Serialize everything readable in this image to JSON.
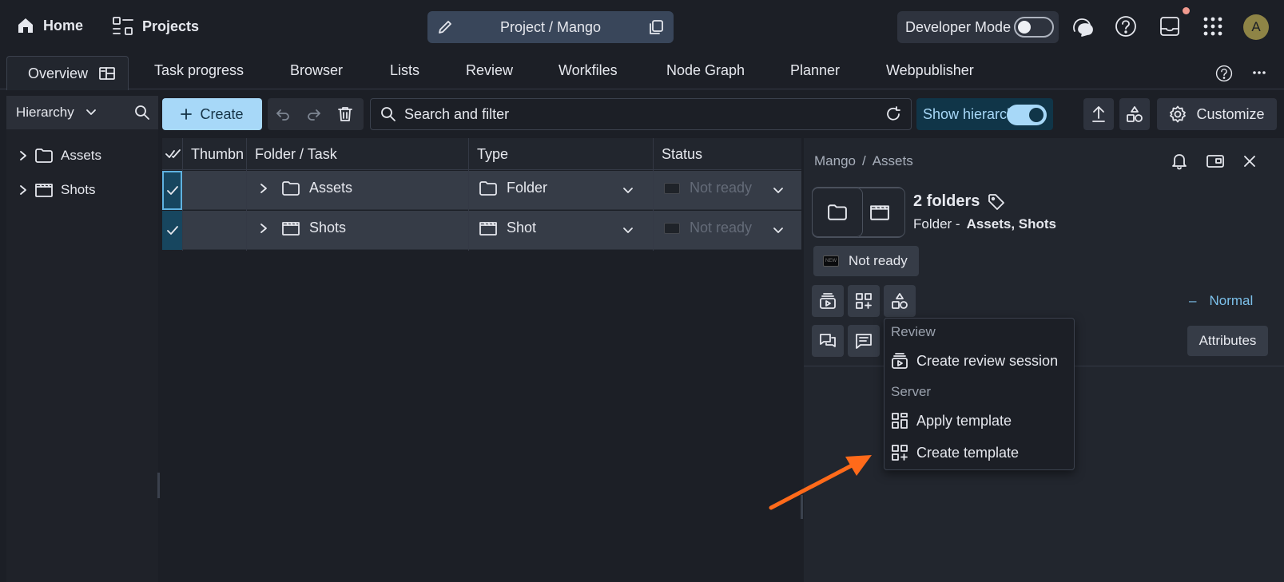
{
  "topbar": {
    "home_label": "Home",
    "projects_label": "Projects",
    "project_path": "Project / Mango",
    "developer_mode_label": "Developer Mode",
    "developer_mode_on": false,
    "avatar_initial": "A"
  },
  "tabs": [
    {
      "label": "Overview",
      "active": true
    },
    {
      "label": "Task progress"
    },
    {
      "label": "Browser"
    },
    {
      "label": "Lists"
    },
    {
      "label": "Review"
    },
    {
      "label": "Workfiles"
    },
    {
      "label": "Node Graph"
    },
    {
      "label": "Planner"
    },
    {
      "label": "Webpublisher"
    }
  ],
  "hierarchy": {
    "label": "Hierarchy",
    "items": [
      {
        "label": "Assets",
        "icon": "folder-icon"
      },
      {
        "label": "Shots",
        "icon": "clapperboard-icon"
      }
    ]
  },
  "toolbar": {
    "create_label": "Create",
    "search_placeholder": "Search and filter",
    "show_hierarchy_label": "Show hierarchy",
    "show_hierarchy_on": true,
    "customize_label": "Customize"
  },
  "table": {
    "columns": [
      "Thumbn",
      "Folder / Task",
      "Type",
      "Status"
    ],
    "rows": [
      {
        "name": "Assets",
        "type": "Folder",
        "status": "Not ready",
        "selected": true
      },
      {
        "name": "Shots",
        "type": "Shot",
        "status": "Not ready",
        "selected": true
      }
    ]
  },
  "details": {
    "breadcrumb": [
      "Mango",
      "Assets"
    ],
    "breadcrumb_sep": "/",
    "title": "2 folders",
    "subtitle_prefix": "Folder -",
    "subtitle_items": "Assets, Shots",
    "status_label": "Not ready",
    "status_tag": "NEW",
    "priority_dash": "–",
    "priority_label": "Normal",
    "attributes_label": "Attributes"
  },
  "menu": {
    "sections": [
      {
        "title": "Review",
        "items": [
          {
            "label": "Create review session",
            "icon": "review-session-icon"
          }
        ]
      },
      {
        "title": "Server",
        "items": [
          {
            "label": "Apply template",
            "icon": "apply-template-icon"
          },
          {
            "label": "Create template",
            "icon": "create-template-icon"
          }
        ]
      }
    ]
  },
  "colors": {
    "accent": "#a7d8f8",
    "annotation_arrow": "#ff6a1a",
    "background": "#1c1f26",
    "selected_row": "#363c47"
  }
}
